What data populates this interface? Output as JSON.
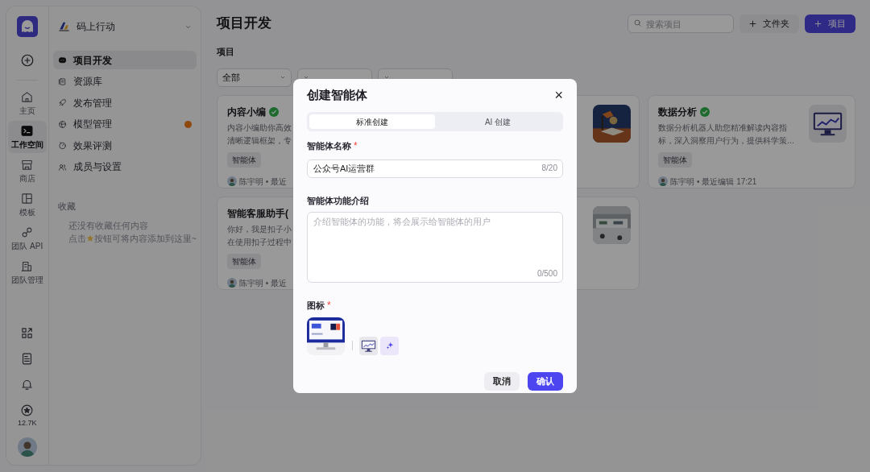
{
  "rail": {
    "items": [
      {
        "label": "主页",
        "selected": false
      },
      {
        "label": "工作空间",
        "selected": true
      },
      {
        "label": "商店",
        "selected": false
      },
      {
        "label": "模板",
        "selected": false
      },
      {
        "label": "团队 API",
        "selected": false
      },
      {
        "label": "团队管理",
        "selected": false
      }
    ],
    "star_count": "12.7K"
  },
  "workspace": {
    "name": "码上行动"
  },
  "menu": [
    {
      "label": "项目开发",
      "selected": true,
      "badge": false
    },
    {
      "label": "资源库",
      "selected": false,
      "badge": false
    },
    {
      "label": "发布管理",
      "selected": false,
      "badge": false
    },
    {
      "label": "模型管理",
      "selected": false,
      "badge": true
    },
    {
      "label": "效果评测",
      "selected": false,
      "badge": false
    },
    {
      "label": "成员与设置",
      "selected": false,
      "badge": false
    }
  ],
  "favorites": {
    "title": "收藏",
    "empty_line": "还没有收藏任何内容",
    "hint_before": "点击",
    "hint_after": "按钮可将内容添加到这里~"
  },
  "page": {
    "title": "项目开发",
    "search": {
      "placeholder": "搜索项目"
    },
    "buttons": [
      {
        "label": "文件夹",
        "kind": "secondary"
      },
      {
        "label": "项目",
        "kind": "primary"
      }
    ],
    "section": "项目",
    "filters": [
      {
        "kind": "dropdown",
        "label": "全部"
      },
      {
        "kind": "dropdown"
      },
      {
        "kind": "dropdown"
      }
    ]
  },
  "cards": [
    {
      "title": "内容小编",
      "verified": true,
      "desc": [
        "内容小编助你高效",
        "清晰逻辑框架，专"
      ],
      "tag": "智能体",
      "footer": "陈宇明 • 最近"
    },
    {
      "image": {
        "kind": "picture"
      }
    },
    {
      "title": "数据分析",
      "verified": true,
      "desc": [
        "数据分析机器人助您精准解读内容指",
        "标，深入洞察用户行为，提供科学策..."
      ],
      "tag": "智能体",
      "footer": "陈宇明 • 最近编辑 17:21",
      "image": {
        "kind": "picture"
      }
    },
    {
      "title": "智能客服助手(",
      "verified": false,
      "desc": [
        "你好，我是扣子小",
        "在使用扣子过程中"
      ],
      "tag": "智能体",
      "footer": "陈宇明 • 最近"
    },
    {
      "image": {
        "kind": "picture"
      }
    }
  ],
  "modal": {
    "title": "创建智能体",
    "close": "×",
    "tabs": [
      {
        "label": "标准创建",
        "selected": true
      },
      {
        "label": "AI 创建",
        "selected": false
      }
    ],
    "name_field": {
      "label": "智能体名称",
      "required_mark": "*",
      "value": "公众号AI运营群",
      "counter": "8/20"
    },
    "desc_field": {
      "label": "智能体功能介绍",
      "placeholder": "介绍智能体的功能，将会展示给智能体的用户",
      "counter": "0/500"
    },
    "icon_field": {
      "label": "图标",
      "required_mark": "*",
      "preview": {
        "kind": "picture"
      },
      "thumb": {
        "kind": "picture"
      }
    },
    "buttons": [
      {
        "label": "取消",
        "kind": "secondary"
      },
      {
        "label": "确认",
        "kind": "primary"
      }
    ]
  }
}
